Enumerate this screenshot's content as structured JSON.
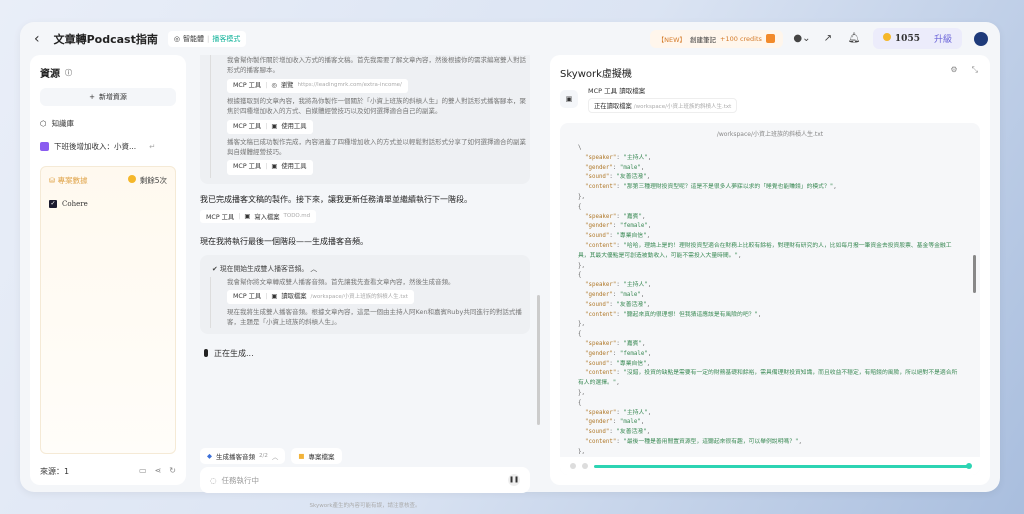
{
  "header": {
    "title": "文章轉Podcast指南",
    "agent": "智能體",
    "mode": "播客模式",
    "new_tag": "【NEW】",
    "new_label": "創建筆記",
    "new_credits": "+100 credits",
    "credits": "1055",
    "upgrade": "升級"
  },
  "sidebar": {
    "title": "資源",
    "add_label": "新增資源",
    "knowledge": "知識庫",
    "doc": "下班後增加收入：小資...",
    "project_title": "專案數據",
    "remaining": "剩餘5次",
    "checkbox_label": "Cohere",
    "sources": "來源：1"
  },
  "chat": {
    "sub1_text1": "我會幫你製作關於增加收入方式的播客文稿。首先我需要了解文章內容，然後根據你的需求編寫雙人對話形式的播客腳本。",
    "tool1": {
      "label": "MCP 工具",
      "action": "瀏覽",
      "arg": "https://leadingmrk.com/extra-income/"
    },
    "sub1_text2": "根據獲取到的文章內容，我將為你製作一個關於「小資上班族的斜槓人生」的雙人對話形式播客腳本，聚焦於四種增加收入的方式、自媒體經營技巧以及如何選擇適合自己的副業。",
    "tool2": {
      "label": "MCP 工具",
      "action": "使用工具",
      "arg": ""
    },
    "sub1_text3": "播客文稿已成功製作完成，內容涵蓋了四種增加收入的方式並以輕鬆對話形式分享了如何選擇適合的副業與自媒體經營技巧。",
    "tool3": {
      "label": "MCP 工具",
      "action": "使用工具",
      "arg": ""
    },
    "msg1": "我已完成播客文稿的製作。接下來，讓我更新任務清單並繼續執行下一階段。",
    "tool4": {
      "label": "MCP 工具",
      "action": "寫入檔案",
      "arg": "TODO.md"
    },
    "msg2": "現在我將執行最後一個階段——生成播客音頻。",
    "step_title": "現在開始生成雙人播客音頻。",
    "sub2_text1": "我會幫你將文章轉成雙人播客音頻。首先讓我先查看文章內容，然後生成音頻。",
    "tool5": {
      "label": "MCP 工具",
      "action": "讀取檔案",
      "arg": "/workspace/小資上班族的斜槓人生.txt"
    },
    "sub2_text2": "現在我將生成雙人播客音頻。根據文章內容，這是一個由主持人阿Ken和嘉賓Ruby共同進行的對話式播客，主題是「小資上班族的斜槓人生」。",
    "generating": "正在生成...",
    "chip1": "生成播客音頻",
    "chip1_count": "2/2",
    "chip2": "專案檔案",
    "input_placeholder": "任務執行中",
    "disclaimer": "Skywork產生的內容可能有誤，請注意核查。"
  },
  "vm": {
    "title": "Skywork虛擬機",
    "tool_label": "MCP 工具 讀取檔案",
    "status": "正在讀取檔案",
    "path": "/workspace/小資上班族的斜槓人生.txt",
    "entries": [
      {
        "speaker": "主持人",
        "gender": "male",
        "sound": "友善活潑",
        "content": "那第三種理財投資型呢？這是不是很多人夢寐以求的「睡覺也能賺錢」的模式？"
      },
      {
        "speaker": "嘉賓",
        "gender": "female",
        "sound": "專業自信",
        "content": "哈哈，理論上是的！理財投資型適合在財務上比較有餘裕，對理財有研究的人，比如每月撥一筆資金去投資股票、基金等金融工具，其最大優點是可創造被動收入，可能不需投入大量時間。"
      },
      {
        "speaker": "主持人",
        "gender": "male",
        "sound": "友善活潑",
        "content": "聽起來真的很理想！但我猜這應該是有風險的吧？"
      },
      {
        "speaker": "嘉賓",
        "gender": "female",
        "sound": "專業自信",
        "content": "沒錯，投資的缺點是需要有一定的財務基礎和餘裕，需具備理財投資知識，而且收益不穩定，有賠錢的風險，所以絕對不是適合所有人的選擇。"
      },
      {
        "speaker": "主持人",
        "gender": "male",
        "sound": "友善活潑",
        "content": "最後一種是善用閒置資源型，這聽起來很有趣，可以舉例說明嗎？"
      },
      {
        "speaker": "嘉賓",
        "gender": "female",
        "sound": "",
        "content": ""
      }
    ],
    "scroll_progress": 1.0
  }
}
